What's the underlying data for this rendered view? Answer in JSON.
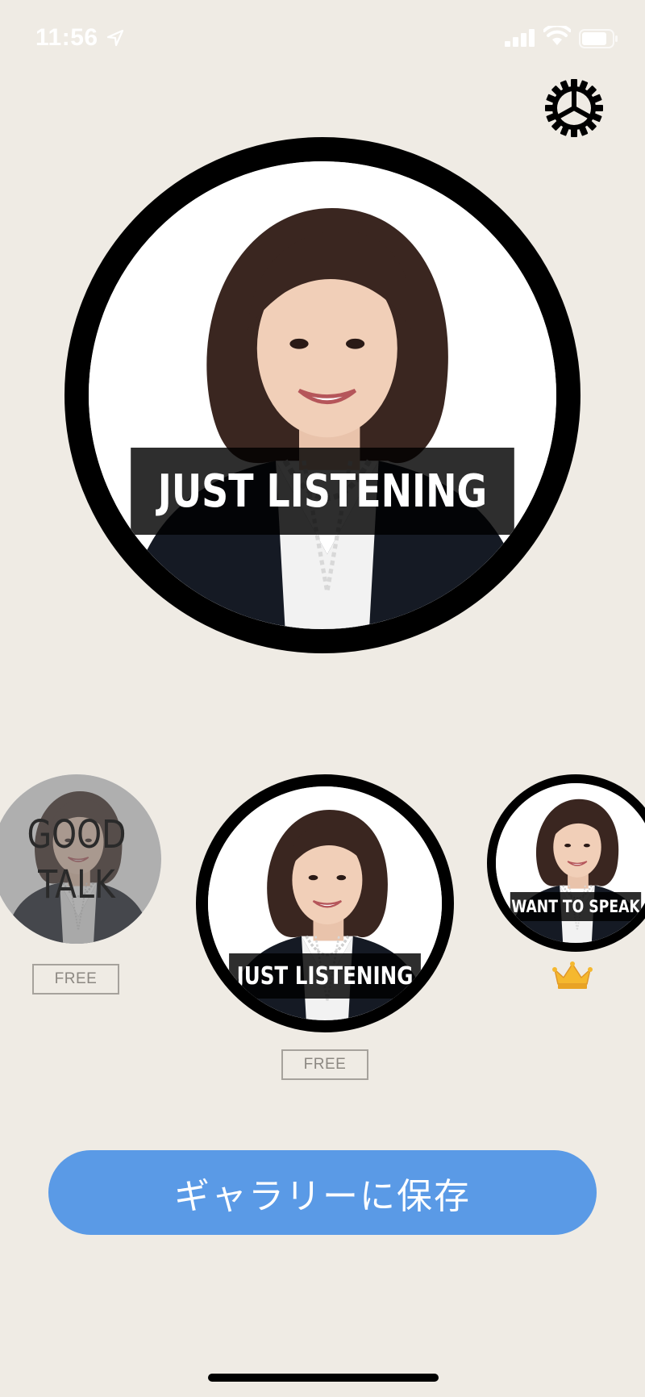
{
  "status_bar": {
    "time": "11:56",
    "icons": [
      "location-arrow-icon",
      "signal-icon",
      "wifi-icon",
      "battery-icon"
    ]
  },
  "settings": {
    "icon": "gear-icon"
  },
  "preview": {
    "label": "JUST LISTENING"
  },
  "carousel": {
    "items": [
      {
        "label": "GOOD TALK",
        "badge": "FREE",
        "state": "dimmed"
      },
      {
        "label": "JUST LISTENING",
        "badge": "FREE",
        "state": "selected"
      },
      {
        "label": "WANT TO SPEAK",
        "badge_icon": "crown-icon",
        "state": "premium"
      }
    ]
  },
  "actions": {
    "save_label": "ギャラリーに保存"
  },
  "colors": {
    "background": "#efebe4",
    "save_button": "#5a9ae6",
    "banner": "#000000",
    "crown": "#f5b82e"
  }
}
